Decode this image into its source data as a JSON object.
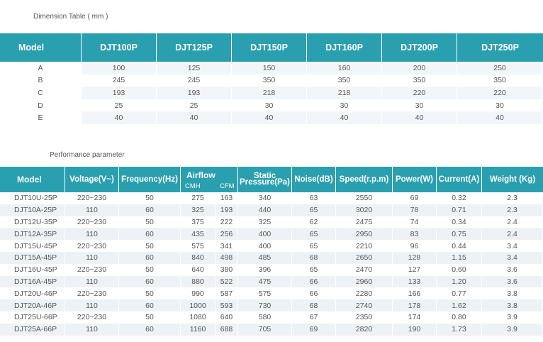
{
  "dimension": {
    "heading": "Dimension Table ( mm )",
    "headers": [
      "Model",
      "DJT100P",
      "DJT125P",
      "DJT150P",
      "DJT160P",
      "DJT200P",
      "DJT250P"
    ],
    "rows": [
      [
        "A",
        "100",
        "125",
        "150",
        "160",
        "200",
        "250"
      ],
      [
        "B",
        "245",
        "245",
        "350",
        "350",
        "350",
        "350"
      ],
      [
        "C",
        "193",
        "193",
        "218",
        "218",
        "220",
        "220"
      ],
      [
        "D",
        "25",
        "25",
        "30",
        "30",
        "30",
        "30"
      ],
      [
        "E",
        "40",
        "40",
        "40",
        "40",
        "40",
        "40"
      ]
    ]
  },
  "performance": {
    "heading": "Performance parameter",
    "headers": {
      "model": "Model",
      "voltage": "Voltage(V~)",
      "frequency": "Frequency(Hz)",
      "airflow": "Airflow",
      "cmh": "CMH",
      "cfm": "CFM",
      "static_1": "Static",
      "static_2": "Pressure(Pa)",
      "noise": "Noise(dB)",
      "speed": "Speed(r.p.m)",
      "power": "Power(W)",
      "current": "Current(A)",
      "weight": "Weight (Kg)"
    },
    "rows": [
      [
        "DJT10U-25P",
        "220~230",
        "50",
        "275",
        "163",
        "340",
        "63",
        "2550",
        "69",
        "0.32",
        "2.3"
      ],
      [
        "DJT10A-25P",
        "110",
        "60",
        "325",
        "193",
        "440",
        "65",
        "3020",
        "78",
        "0.71",
        "2.3"
      ],
      [
        "DJT12U-35P",
        "220~230",
        "50",
        "375",
        "222",
        "325",
        "62",
        "2475",
        "74",
        "0.34",
        "2.4"
      ],
      [
        "DJT12A-35P",
        "110",
        "60",
        "435",
        "256",
        "400",
        "65",
        "2950",
        "83",
        "0.75",
        "2.4"
      ],
      [
        "DJT15U-45P",
        "220~230",
        "50",
        "575",
        "341",
        "400",
        "65",
        "2210",
        "96",
        "0.44",
        "3.4"
      ],
      [
        "DJT15A-45P",
        "110",
        "60",
        "840",
        "498",
        "485",
        "68",
        "2650",
        "128",
        "1.15",
        "3.4"
      ],
      [
        "DJT16U-45P",
        "220~230",
        "50",
        "640",
        "380",
        "396",
        "65",
        "2470",
        "127",
        "0.60",
        "3.6"
      ],
      [
        "DJT16A-45P",
        "110",
        "60",
        "880",
        "522",
        "475",
        "66",
        "2960",
        "133",
        "1.20",
        "3.6"
      ],
      [
        "DJT20U-46P",
        "220~230",
        "50",
        "990",
        "587",
        "575",
        "66",
        "2280",
        "166",
        "0.77",
        "3.8"
      ],
      [
        "DJT20A-46P",
        "110",
        "60",
        "1000",
        "593",
        "730",
        "68",
        "2740",
        "178",
        "1.62",
        "3.8"
      ],
      [
        "DJT25U-66P",
        "220~230",
        "50",
        "1080",
        "640",
        "580",
        "67",
        "2350",
        "174",
        "0.80",
        "3.9"
      ],
      [
        "DJT25A-66P",
        "110",
        "60",
        "1160",
        "688",
        "705",
        "69",
        "2820",
        "190",
        "1.73",
        "3.9"
      ]
    ]
  }
}
